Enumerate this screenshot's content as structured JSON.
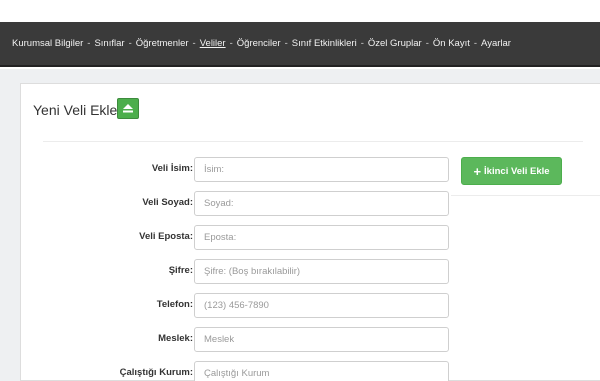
{
  "nav": {
    "items": [
      {
        "label": "Kurumsal Bilgiler"
      },
      {
        "label": "Sınıflar"
      },
      {
        "label": "Öğretmenler"
      },
      {
        "label": "Veliler"
      },
      {
        "label": "Öğrenciler"
      },
      {
        "label": "Sınıf Etkinlikleri"
      },
      {
        "label": "Özel Gruplar"
      },
      {
        "label": "Ön Kayıt"
      },
      {
        "label": "Ayarlar"
      }
    ],
    "separator": "-",
    "active_item": "Veliler"
  },
  "panel": {
    "title": "Yeni Veli Ekle",
    "collapse_icon": "eject-icon"
  },
  "form": {
    "fields": [
      {
        "label": "Veli İsim:",
        "placeholder": "İsim:",
        "value": ""
      },
      {
        "label": "Veli Soyad:",
        "placeholder": "Soyad:",
        "value": ""
      },
      {
        "label": "Veli Eposta:",
        "placeholder": "Eposta:",
        "value": ""
      },
      {
        "label": "Şifre:",
        "placeholder": "Şifre: (Boş bırakılabilir)",
        "value": ""
      },
      {
        "label": "Telefon:",
        "placeholder": "(123) 456-7890",
        "value": ""
      },
      {
        "label": "Meslek:",
        "placeholder": "Meslek",
        "value": ""
      },
      {
        "label": "Çalıştığı Kurum:",
        "placeholder": "Çalıştığı Kurum",
        "value": ""
      }
    ],
    "add_second_button": {
      "label": "İkinci Veli Ekle",
      "icon": "plus-icon"
    }
  },
  "colors": {
    "nav_background": "#3a3a3a",
    "success_green": "#5cb85c"
  }
}
